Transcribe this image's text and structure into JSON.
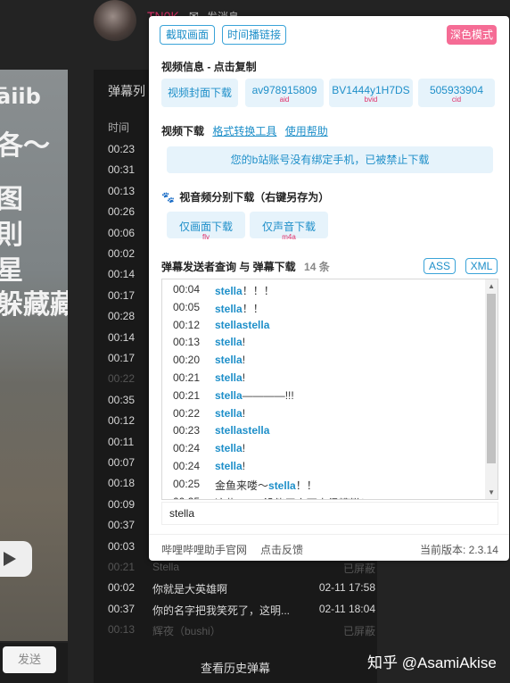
{
  "header": {
    "username": "TN0K",
    "mail_icon": "mail-icon",
    "mail_text": "发消息"
  },
  "video": {
    "overlay_lines": [
      "āiib",
      "。。",
      "各～",
      "图",
      "則",
      "星",
      "躲藏藏"
    ],
    "send_button": "发送"
  },
  "danmaku_list": {
    "title": "弹幕列",
    "col_time": "时间",
    "rows": [
      {
        "time": "00:23",
        "content": "",
        "date": "",
        "dim": false
      },
      {
        "time": "00:31",
        "content": "",
        "date": "",
        "dim": false
      },
      {
        "time": "00:13",
        "content": "",
        "date": "",
        "dim": false
      },
      {
        "time": "00:26",
        "content": "",
        "date": "",
        "dim": false
      },
      {
        "time": "00:06",
        "content": "",
        "date": "",
        "dim": false
      },
      {
        "time": "00:02",
        "content": "",
        "date": "",
        "dim": false
      },
      {
        "time": "00:14",
        "content": "",
        "date": "",
        "dim": false
      },
      {
        "time": "00:17",
        "content": "",
        "date": "",
        "dim": false
      },
      {
        "time": "00:28",
        "content": "",
        "date": "",
        "dim": false
      },
      {
        "time": "00:14",
        "content": "",
        "date": "",
        "dim": false
      },
      {
        "time": "00:17",
        "content": "",
        "date": "",
        "dim": false
      },
      {
        "time": "00:22",
        "content": "",
        "date": "",
        "dim": true
      },
      {
        "time": "00:35",
        "content": "",
        "date": "",
        "dim": false
      },
      {
        "time": "00:12",
        "content": "",
        "date": "",
        "dim": false
      },
      {
        "time": "00:11",
        "content": "",
        "date": "",
        "dim": false
      },
      {
        "time": "00:07",
        "content": "",
        "date": "",
        "dim": false
      },
      {
        "time": "00:18",
        "content": "",
        "date": "",
        "dim": false
      },
      {
        "time": "00:09",
        "content": "",
        "date": "",
        "dim": false
      },
      {
        "time": "00:37",
        "content": "",
        "date": "",
        "dim": false
      },
      {
        "time": "00:03",
        "content": "",
        "date": "",
        "dim": false
      },
      {
        "time": "00:21",
        "content": "Stella",
        "date": "已屏蔽",
        "dim": true
      },
      {
        "time": "00:02",
        "content": "你就是大英雄啊",
        "date": "02-11 17:58",
        "dim": false
      },
      {
        "time": "00:37",
        "content": "你的名字把我笑死了，这明...",
        "date": "02-11 18:04",
        "dim": false
      },
      {
        "time": "00:13",
        "content": "辉夜（bushi）",
        "date": "已屏蔽",
        "dim": true
      }
    ],
    "history_button": "查看历史弹幕"
  },
  "watermark": "知乎 @AsamiAkise",
  "panel": {
    "top_buttons": [
      "截取画面",
      "时间播链接"
    ],
    "dark_mode": "深色模式",
    "video_info": {
      "title": "视频信息 - 点击复制",
      "cover_button": "视频封面下载",
      "aid": {
        "value": "av978915809",
        "label": "aid"
      },
      "bvid": {
        "value": "BV1444y1H7DS",
        "label": "bvid"
      },
      "cid": {
        "value": "505933904",
        "label": "cid"
      }
    },
    "video_download": {
      "title": "视频下载",
      "format_tool": "格式转换工具",
      "help": "使用帮助",
      "notice": "您的b站账号没有绑定手机，已被禁止下载"
    },
    "separate": {
      "paw_icon": "paw-icon",
      "title": "视音频分别下载（右键另存为）",
      "video_only": "仅画面下载",
      "video_only_sub": "flv",
      "audio_only": "仅声音下载",
      "audio_only_sub": "m4a"
    },
    "query": {
      "title": "弹幕发送者查询 与 弹幕下载",
      "count": "14 条",
      "ass": "ASS",
      "xml": "XML",
      "results": [
        {
          "time": "00:04",
          "pre": "",
          "hl": "stella",
          "post": "！！！"
        },
        {
          "time": "00:05",
          "pre": "",
          "hl": "stella",
          "post": "！！"
        },
        {
          "time": "00:12",
          "pre": "",
          "hl": "stellastella",
          "post": ""
        },
        {
          "time": "00:13",
          "pre": "",
          "hl": "stella",
          "post": "!"
        },
        {
          "time": "00:20",
          "pre": "",
          "hl": "stella",
          "post": "!"
        },
        {
          "time": "00:21",
          "pre": "",
          "hl": "stella",
          "post": "!"
        },
        {
          "time": "00:21",
          "pre": "",
          "hl": "stella",
          "post": "————!!!"
        },
        {
          "time": "00:22",
          "pre": "",
          "hl": "stella",
          "post": "!"
        },
        {
          "time": "00:23",
          "pre": "",
          "hl": "stellastella",
          "post": ""
        },
        {
          "time": "00:24",
          "pre": "",
          "hl": "stella",
          "post": "!"
        },
        {
          "time": "00:24",
          "pre": "",
          "hl": "stella",
          "post": "!"
        },
        {
          "time": "00:25",
          "pre": "金鱼来喽～",
          "hl": "stella",
          "post": "！！"
        },
        {
          "time": "00:25",
          "pre": "这些",
          "hl": "stella",
          "post": "没能平安下来很糟糕！"
        }
      ],
      "search_value": "stella"
    },
    "footer": {
      "official_site": "哔哩哔哩助手官网",
      "feedback": "点击反馈",
      "version": "当前版本: 2.3.14"
    }
  }
}
